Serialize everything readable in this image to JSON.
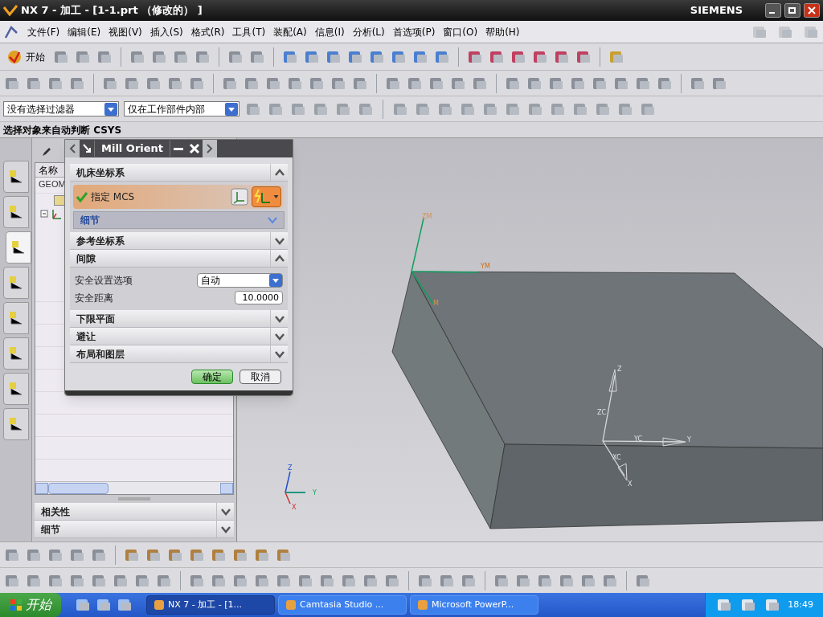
{
  "window": {
    "title": "NX 7 - 加工 - [1-1.prt （修改的） ]",
    "brand": "SIEMENS"
  },
  "menu": [
    "文件(F)",
    "编辑(E)",
    "视图(V)",
    "插入(S)",
    "格式(R)",
    "工具(T)",
    "装配(A)",
    "信息(I)",
    "分析(L)",
    "首选项(P)",
    "窗口(O)",
    "帮助(H)"
  ],
  "toolbar": {
    "start_button": "开始"
  },
  "filters": [
    {
      "value": "没有选择过滤器"
    },
    {
      "value": "仅在工作部件内部"
    }
  ],
  "cue_line": "选择对象来自动判断 CSYS",
  "resource_tabs": [
    {
      "selected": false
    },
    {
      "selected": false
    },
    {
      "selected": true
    },
    {
      "selected": false
    },
    {
      "selected": false
    },
    {
      "selected": false
    },
    {
      "selected": false
    },
    {
      "selected": false
    }
  ],
  "navigator": {
    "columns": [
      "名称"
    ],
    "rows": [
      "GEOM"
    ],
    "sections": [
      {
        "title": "相关性",
        "expanded": false
      },
      {
        "title": "细节",
        "expanded": false
      }
    ]
  },
  "dialog": {
    "title": "Mill Orient",
    "sections": [
      {
        "title": "机床坐标系",
        "expanded": true,
        "kind": "mcs",
        "item": {
          "label": "指定 MCS",
          "checked": true
        },
        "subsection": {
          "title": "细节",
          "expanded": false
        }
      },
      {
        "title": "参考坐标系",
        "expanded": false
      },
      {
        "title": "间隙",
        "expanded": true,
        "kind": "clearance",
        "fields": [
          {
            "label": "安全设置选项",
            "kind": "select",
            "value": "自动"
          },
          {
            "label": "安全距离",
            "kind": "number",
            "value": "10.0000"
          }
        ]
      },
      {
        "title": "下限平面",
        "expanded": false
      },
      {
        "title": "避让",
        "expanded": false
      },
      {
        "title": "布局和图层",
        "expanded": false
      }
    ],
    "buttons": [
      {
        "label": "确定",
        "default": true
      },
      {
        "label": "取消",
        "default": false
      }
    ]
  },
  "viewport": {
    "mcs_labels": [
      "ZM",
      "YM",
      "M"
    ],
    "wcs_labels": [
      "Z",
      "ZC",
      "YC",
      "Y",
      "XC",
      "X"
    ],
    "view_triad_labels": [
      "Z",
      "Y",
      "X"
    ]
  },
  "taskbar": {
    "start": "开始",
    "tasks": [
      {
        "label": "NX 7 - 加工 - [1...",
        "selected": true
      },
      {
        "label": "Camtasia Studio ...",
        "selected": false
      },
      {
        "label": "Microsoft PowerP...",
        "selected": false
      }
    ],
    "clock": "18:49"
  }
}
